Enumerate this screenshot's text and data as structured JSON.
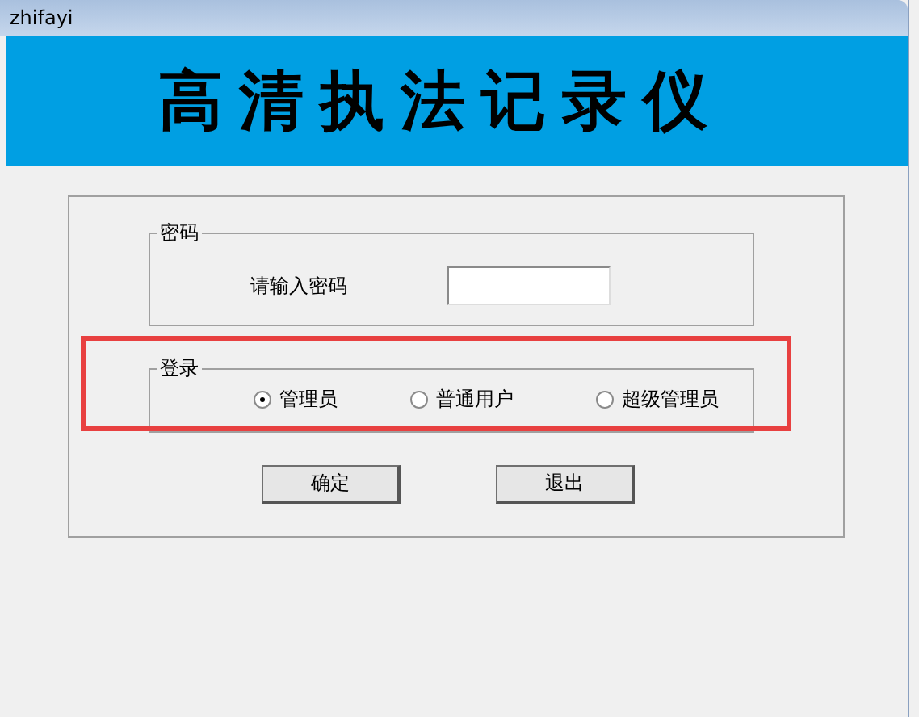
{
  "window": {
    "title": "zhifayi"
  },
  "banner": {
    "title": "高清执法记录仪"
  },
  "password_group": {
    "label": "密码",
    "prompt": "请输入密码"
  },
  "login_group": {
    "label": "登录",
    "options": [
      {
        "label": "管理员",
        "selected": true
      },
      {
        "label": "普通用户",
        "selected": false
      },
      {
        "label": "超级管理员",
        "selected": false
      }
    ]
  },
  "buttons": [
    "确定",
    "退出"
  ]
}
